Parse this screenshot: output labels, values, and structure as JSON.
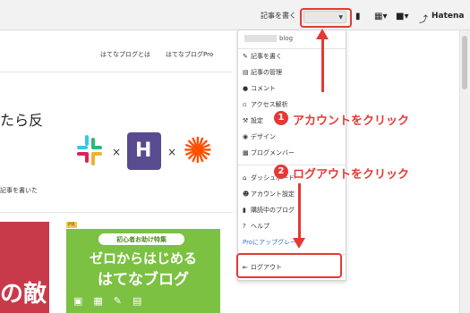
{
  "topbar": {
    "write_label": "記事を書く",
    "hatena_label": "Hatena",
    "icons": [
      "bookmark-icon",
      "grid-icon",
      "message-icon",
      "hatena-logo-icon"
    ]
  },
  "page": {
    "nav": [
      "はてなブログとは",
      "はてなブログPro"
    ],
    "headline": "たら反",
    "subtext": "記事を書いた",
    "logo_separator": "×",
    "pr_tag": "PR",
    "banner": {
      "pill": "初心者お助け特集",
      "line1": "ゼロからはじめる",
      "line2": "はてなブログ"
    },
    "red_image_text": "の敵"
  },
  "menu": {
    "blog_suffix": "blog",
    "items": [
      {
        "icon": "pencil-icon",
        "label": "記事を書く"
      },
      {
        "icon": "document-icon",
        "label": "記事の管理"
      },
      {
        "icon": "comment-icon",
        "label": "コメント"
      },
      {
        "icon": "chart-icon",
        "label": "アクセス解析"
      },
      {
        "icon": "wrench-icon",
        "label": "設定"
      },
      {
        "icon": "palette-icon",
        "label": "デザイン"
      },
      {
        "icon": "users-icon",
        "label": "ブログメンバー"
      }
    ],
    "items2": [
      {
        "icon": "home-icon",
        "label": "ダッシュボード"
      },
      {
        "icon": "user-icon",
        "label": "アカウント設定"
      },
      {
        "icon": "bookmark-icon",
        "label": "購読中のブログ"
      },
      {
        "icon": "help-icon",
        "label": "ヘルプ"
      }
    ],
    "upgrade_label": "Proにアップグレード",
    "logout_label": "ログアウト"
  },
  "annotations": {
    "step1_number": "1",
    "step1_text": "アカウントをクリック",
    "step2_number": "2",
    "step2_text": "ログアウトをクリック"
  },
  "colors": {
    "annotation_red": "#e53935",
    "banner_green": "#7cc142",
    "link_blue": "#3a75c4"
  }
}
